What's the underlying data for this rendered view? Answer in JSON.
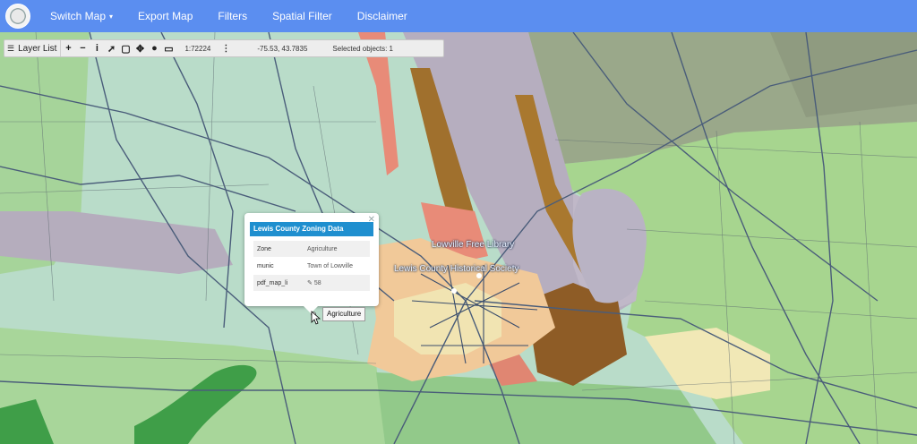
{
  "nav": {
    "items": [
      {
        "label": "Switch Map",
        "caret": "▾"
      },
      {
        "label": "Export Map"
      },
      {
        "label": "Filters"
      },
      {
        "label": "Spatial Filter"
      },
      {
        "label": "Disclaimer"
      }
    ]
  },
  "toolbar": {
    "layer_list_label": "Layer List",
    "scale": "1:72224",
    "coordinates": "-75.53, 43.7835",
    "selected_objects": "Selected objects: 1",
    "tools": [
      "zoom-in",
      "zoom-out",
      "identify",
      "select",
      "box-select",
      "pan",
      "globe",
      "measure"
    ]
  },
  "popup": {
    "title": "Lewis County Zoning Data",
    "rows": [
      {
        "key": "Zone",
        "value": "Agriculture"
      },
      {
        "key": "munic",
        "value": "Town of Lowville"
      },
      {
        "key": "pdf_map_li",
        "value": "58"
      }
    ]
  },
  "tooltip": "Agriculture",
  "map_labels": {
    "library": "Lowville Free Library",
    "society": "Lewis County Historical Society"
  },
  "colors": {
    "nav_bg": "#5b8ef0",
    "popup_header": "#1f8fcf",
    "agriculture_green": "#a8d69a",
    "residential_pale": "#b9dcc9",
    "forest_green": "#3f9e48",
    "commercial_brown": "#9d6a2c",
    "industrial_lilac": "#b6aebf",
    "salmon": "#e88b78"
  }
}
